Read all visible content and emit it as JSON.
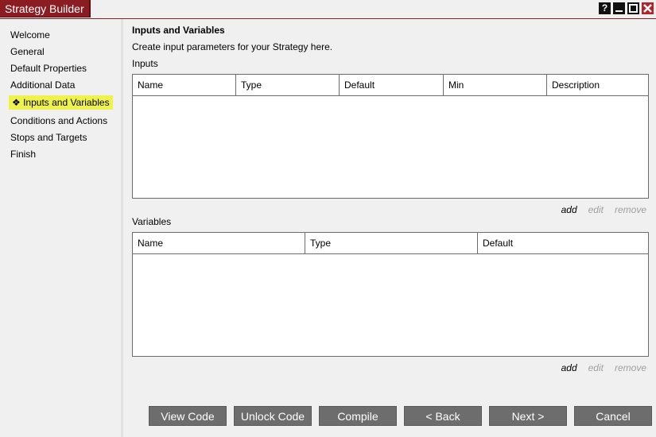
{
  "window": {
    "title": "Strategy Builder",
    "controls": [
      "?",
      "_",
      "□",
      "✕"
    ]
  },
  "sidebar": {
    "items": [
      {
        "label": "Welcome",
        "active": false
      },
      {
        "label": "General",
        "active": false
      },
      {
        "label": "Default Properties",
        "active": false
      },
      {
        "label": "Additional Data",
        "active": false
      },
      {
        "label": "❖ Inputs and Variables",
        "active": true
      },
      {
        "label": "Conditions and Actions",
        "active": false
      },
      {
        "label": "Stops and Targets",
        "active": false
      },
      {
        "label": "Finish",
        "active": false
      }
    ]
  },
  "main": {
    "title": "Inputs and Variables",
    "subtitle": "Create input parameters for your Strategy here.",
    "inputs": {
      "label": "Inputs",
      "columns": [
        "Name",
        "Type",
        "Default",
        "Min",
        "Description"
      ],
      "actions": {
        "add": "add",
        "edit": "edit",
        "remove": "remove"
      }
    },
    "variables": {
      "label": "Variables",
      "columns": [
        "Name",
        "Type",
        "Default"
      ],
      "actions": {
        "add": "add",
        "edit": "edit",
        "remove": "remove"
      }
    }
  },
  "buttons": {
    "view_code": "View Code",
    "unlock_code": "Unlock Code",
    "compile": "Compile",
    "back": "< Back",
    "next": "Next >",
    "cancel": "Cancel"
  },
  "colors": {
    "title_bg": "#8a1c22",
    "active_nav": "#eef24a",
    "button_bg": "#6d6d6d"
  }
}
